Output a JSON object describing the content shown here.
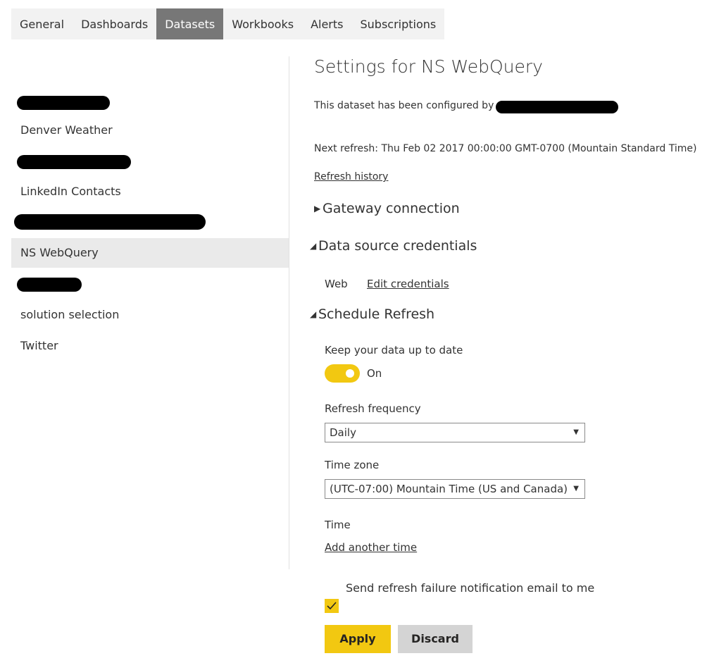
{
  "tabs": [
    {
      "label": "General"
    },
    {
      "label": "Dashboards"
    },
    {
      "label": "Datasets",
      "active": true
    },
    {
      "label": "Workbooks"
    },
    {
      "label": "Alerts"
    },
    {
      "label": "Subscriptions"
    }
  ],
  "sidebar": {
    "items": [
      {
        "label": "",
        "redacted": true
      },
      {
        "label": "Denver Weather"
      },
      {
        "label": "",
        "redacted": true
      },
      {
        "label": "LinkedIn Contacts"
      },
      {
        "label": "",
        "redacted": true
      },
      {
        "label": "NS WebQuery",
        "selected": true
      },
      {
        "label": "",
        "redacted": true
      },
      {
        "label": "solution selection"
      },
      {
        "label": "Twitter"
      }
    ]
  },
  "main": {
    "title": "Settings for NS WebQuery",
    "configured_by": "This dataset has been configured by",
    "next_refresh": "Next refresh: Thu Feb 02 2017 00:00:00 GMT-0700 (Mountain Standard Time)",
    "refresh_history": "Refresh history",
    "gateway_section": "Gateway connection",
    "credentials_section": "Data source credentials",
    "credentials_source": "Web",
    "edit_credentials": "Edit credentials",
    "schedule_section": "Schedule Refresh",
    "keep_up_to_date": "Keep your data up to date",
    "toggle_state": "On",
    "refresh_frequency_label": "Refresh frequency",
    "refresh_frequency_value": "Daily",
    "time_zone_label": "Time zone",
    "time_zone_value": "(UTC-07:00) Mountain Time (US and Canada)",
    "time_label": "Time",
    "add_time": "Add another time",
    "notify_label": "Send refresh failure notification email to me",
    "notify_checked": true,
    "apply": "Apply",
    "discard": "Discard"
  },
  "colors": {
    "accent": "#f2c811",
    "selected_tab": "#777777",
    "sidebar_selected": "#eaeaea",
    "discard": "#d4d4d4"
  },
  "icons": {
    "collapsed": "triangle-right-icon",
    "expanded": "triangle-down-icon",
    "select_caret": "caret-down-icon",
    "check": "checkmark-icon"
  }
}
